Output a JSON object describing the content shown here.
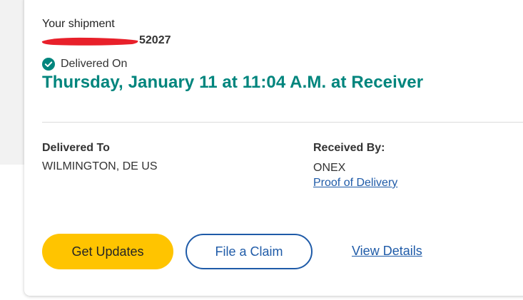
{
  "shipment": {
    "label": "Your shipment",
    "tracking_suffix": "52027"
  },
  "status": {
    "icon": "check-circle-icon",
    "label": "Delivered On",
    "date_time": "Thursday, January 11 at 11:04 A.M. at Receiver"
  },
  "delivered_to": {
    "title": "Delivered To",
    "location": "WILMINGTON, DE US"
  },
  "received_by": {
    "title": "Received By:",
    "name": "ONEX",
    "proof_link": "Proof of Delivery"
  },
  "actions": {
    "get_updates": "Get Updates",
    "file_claim": "File a Claim",
    "view_details": "View Details"
  },
  "colors": {
    "accent_teal": "#00857d",
    "primary_button": "#ffc400",
    "link_blue": "#1f5ba8",
    "redaction_red": "#e8202a"
  }
}
